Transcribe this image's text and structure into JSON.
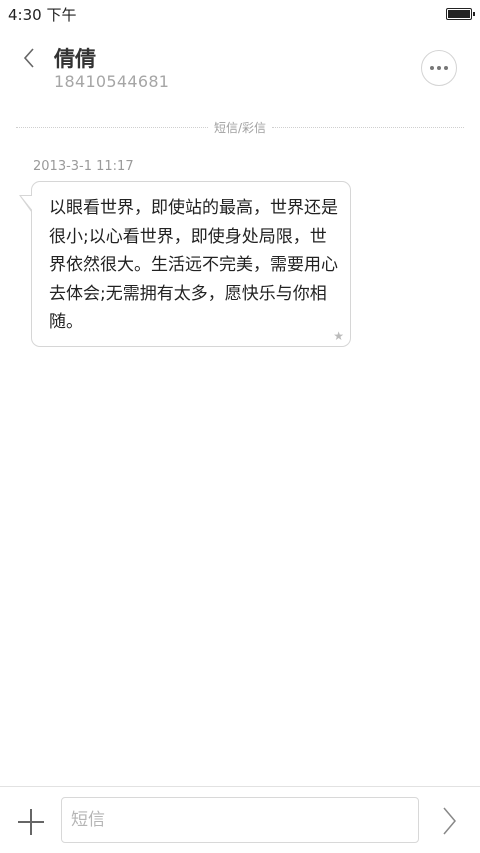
{
  "status_bar": {
    "time": "4:30 下午",
    "battery_icon": "battery-full-icon"
  },
  "header": {
    "back_icon": "chevron-left-icon",
    "contact_name": "倩倩",
    "contact_number": "18410544681",
    "more_icon": "more-dots-icon"
  },
  "thread": {
    "divider_label": "短信/彩信",
    "messages": [
      {
        "timestamp": "2013-3-1 11:17",
        "text": "以眼看世界，即使站的最高，世界还是很小;以心看世界，即使身处局限，世界依然很大。生活远不完美，需要用心去体会;无需拥有太多，愿快乐与你相随。",
        "star_icon": "star-icon"
      }
    ]
  },
  "composer": {
    "add_icon": "plus-icon",
    "input_placeholder": "短信",
    "input_value": "",
    "send_icon": "chevron-right-icon"
  },
  "colors": {
    "background": "#ffffff",
    "bubble_border": "#d6d6d6",
    "secondary_text": "#a6a6a6"
  }
}
